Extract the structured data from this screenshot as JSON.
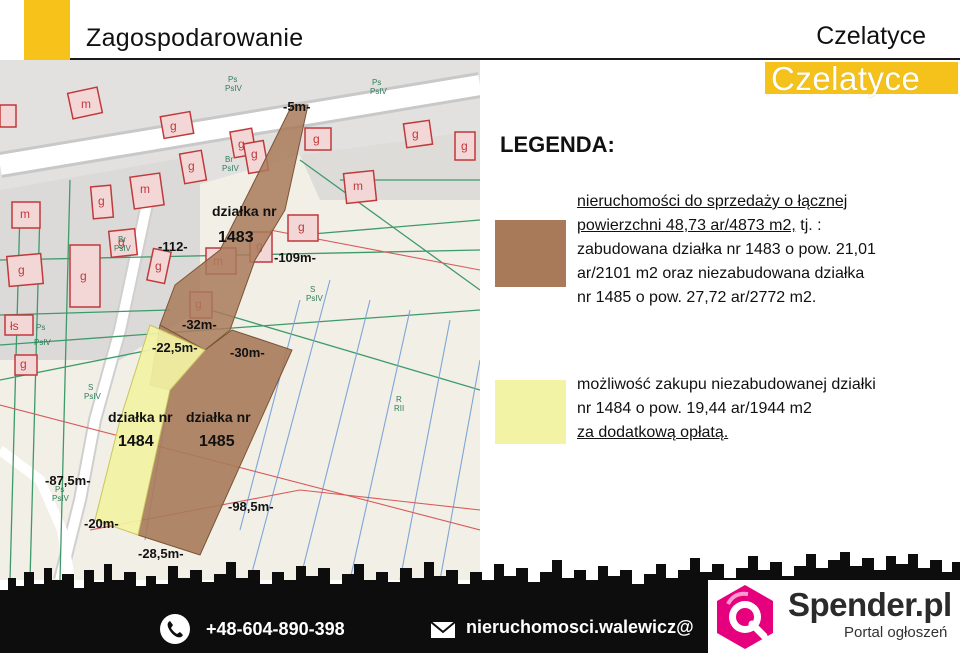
{
  "header": {
    "title": "Zagospodarowanie",
    "place": "Czelatyce",
    "logo_text": "Czelatyce"
  },
  "colors": {
    "accent_yellow": "#f7c21a",
    "parcel_brown": "#a97a5a",
    "parcel_yellow": "#f2f3a4",
    "footer_black": "#0d0d0d"
  },
  "map": {
    "parcels": [
      {
        "label_line1": "działka nr",
        "label_line2": "1483"
      },
      {
        "label_line1": "działka nr",
        "label_line2": "1484"
      },
      {
        "label_line1": "działka nr",
        "label_line2": "1485"
      }
    ],
    "dimensions": [
      "-5m-",
      "-112-",
      "-109m-",
      "-32m-",
      "-22,5m-",
      "-30m-",
      "-87,5m-",
      "-98,5m-",
      "-20m-",
      "-28,5m-"
    ],
    "building_letters": [
      "m",
      "g",
      "mg"
    ],
    "land_codes": [
      "Ps",
      "PsIV",
      "Br",
      "S",
      "R",
      "RII",
      "Ls"
    ]
  },
  "legend": {
    "title": "LEGENDA:",
    "item1": {
      "line1": "nieruchomości do sprzedaży o łącznej",
      "line2": "powierzchni 48,73 ar/4873 m2,",
      "line2_tail": " tj. :",
      "line3": "zabudowana działka nr 1483 o pow. 21,01",
      "line4": "ar/2101 m2 oraz niezabudowana działka",
      "line5": "nr 1485 o pow. 27,72 ar/2772 m2."
    },
    "item2": {
      "line1": "możliwość zakupu niezabudowanej działki",
      "line2": "nr 1484 o pow. 19,44 ar/1944 m2",
      "line3": "za dodatkową opłatą."
    }
  },
  "footer": {
    "phone": "+48-604-890-398",
    "email": "nieruchomosci.walewicz@",
    "phone_icon": "phone-icon",
    "mail_icon": "mail-icon"
  },
  "watermark": {
    "name": "Spender.pl",
    "subtitle": "Portal ogłoszeń"
  }
}
